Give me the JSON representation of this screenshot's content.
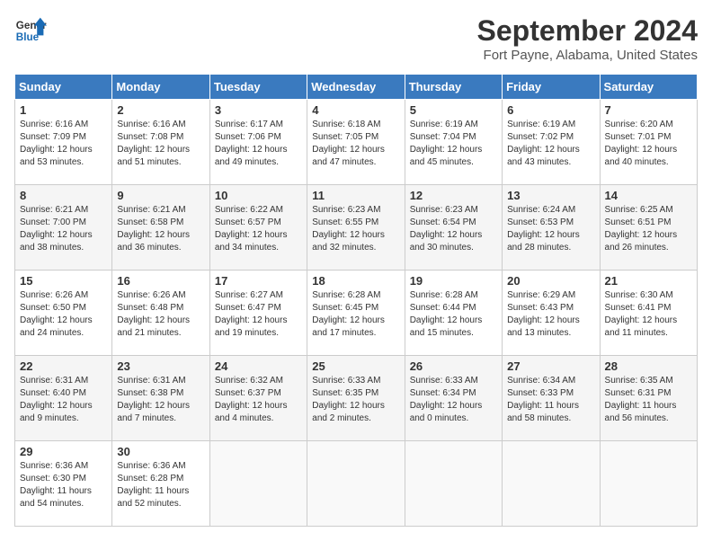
{
  "header": {
    "logo_line1": "General",
    "logo_line2": "Blue",
    "month": "September 2024",
    "location": "Fort Payne, Alabama, United States"
  },
  "weekdays": [
    "Sunday",
    "Monday",
    "Tuesday",
    "Wednesday",
    "Thursday",
    "Friday",
    "Saturday"
  ],
  "weeks": [
    [
      {
        "day": "1",
        "lines": [
          "Sunrise: 6:16 AM",
          "Sunset: 7:09 PM",
          "Daylight: 12 hours",
          "and 53 minutes."
        ]
      },
      {
        "day": "2",
        "lines": [
          "Sunrise: 6:16 AM",
          "Sunset: 7:08 PM",
          "Daylight: 12 hours",
          "and 51 minutes."
        ]
      },
      {
        "day": "3",
        "lines": [
          "Sunrise: 6:17 AM",
          "Sunset: 7:06 PM",
          "Daylight: 12 hours",
          "and 49 minutes."
        ]
      },
      {
        "day": "4",
        "lines": [
          "Sunrise: 6:18 AM",
          "Sunset: 7:05 PM",
          "Daylight: 12 hours",
          "and 47 minutes."
        ]
      },
      {
        "day": "5",
        "lines": [
          "Sunrise: 6:19 AM",
          "Sunset: 7:04 PM",
          "Daylight: 12 hours",
          "and 45 minutes."
        ]
      },
      {
        "day": "6",
        "lines": [
          "Sunrise: 6:19 AM",
          "Sunset: 7:02 PM",
          "Daylight: 12 hours",
          "and 43 minutes."
        ]
      },
      {
        "day": "7",
        "lines": [
          "Sunrise: 6:20 AM",
          "Sunset: 7:01 PM",
          "Daylight: 12 hours",
          "and 40 minutes."
        ]
      }
    ],
    [
      {
        "day": "8",
        "lines": [
          "Sunrise: 6:21 AM",
          "Sunset: 7:00 PM",
          "Daylight: 12 hours",
          "and 38 minutes."
        ]
      },
      {
        "day": "9",
        "lines": [
          "Sunrise: 6:21 AM",
          "Sunset: 6:58 PM",
          "Daylight: 12 hours",
          "and 36 minutes."
        ]
      },
      {
        "day": "10",
        "lines": [
          "Sunrise: 6:22 AM",
          "Sunset: 6:57 PM",
          "Daylight: 12 hours",
          "and 34 minutes."
        ]
      },
      {
        "day": "11",
        "lines": [
          "Sunrise: 6:23 AM",
          "Sunset: 6:55 PM",
          "Daylight: 12 hours",
          "and 32 minutes."
        ]
      },
      {
        "day": "12",
        "lines": [
          "Sunrise: 6:23 AM",
          "Sunset: 6:54 PM",
          "Daylight: 12 hours",
          "and 30 minutes."
        ]
      },
      {
        "day": "13",
        "lines": [
          "Sunrise: 6:24 AM",
          "Sunset: 6:53 PM",
          "Daylight: 12 hours",
          "and 28 minutes."
        ]
      },
      {
        "day": "14",
        "lines": [
          "Sunrise: 6:25 AM",
          "Sunset: 6:51 PM",
          "Daylight: 12 hours",
          "and 26 minutes."
        ]
      }
    ],
    [
      {
        "day": "15",
        "lines": [
          "Sunrise: 6:26 AM",
          "Sunset: 6:50 PM",
          "Daylight: 12 hours",
          "and 24 minutes."
        ]
      },
      {
        "day": "16",
        "lines": [
          "Sunrise: 6:26 AM",
          "Sunset: 6:48 PM",
          "Daylight: 12 hours",
          "and 21 minutes."
        ]
      },
      {
        "day": "17",
        "lines": [
          "Sunrise: 6:27 AM",
          "Sunset: 6:47 PM",
          "Daylight: 12 hours",
          "and 19 minutes."
        ]
      },
      {
        "day": "18",
        "lines": [
          "Sunrise: 6:28 AM",
          "Sunset: 6:45 PM",
          "Daylight: 12 hours",
          "and 17 minutes."
        ]
      },
      {
        "day": "19",
        "lines": [
          "Sunrise: 6:28 AM",
          "Sunset: 6:44 PM",
          "Daylight: 12 hours",
          "and 15 minutes."
        ]
      },
      {
        "day": "20",
        "lines": [
          "Sunrise: 6:29 AM",
          "Sunset: 6:43 PM",
          "Daylight: 12 hours",
          "and 13 minutes."
        ]
      },
      {
        "day": "21",
        "lines": [
          "Sunrise: 6:30 AM",
          "Sunset: 6:41 PM",
          "Daylight: 12 hours",
          "and 11 minutes."
        ]
      }
    ],
    [
      {
        "day": "22",
        "lines": [
          "Sunrise: 6:31 AM",
          "Sunset: 6:40 PM",
          "Daylight: 12 hours",
          "and 9 minutes."
        ]
      },
      {
        "day": "23",
        "lines": [
          "Sunrise: 6:31 AM",
          "Sunset: 6:38 PM",
          "Daylight: 12 hours",
          "and 7 minutes."
        ]
      },
      {
        "day": "24",
        "lines": [
          "Sunrise: 6:32 AM",
          "Sunset: 6:37 PM",
          "Daylight: 12 hours",
          "and 4 minutes."
        ]
      },
      {
        "day": "25",
        "lines": [
          "Sunrise: 6:33 AM",
          "Sunset: 6:35 PM",
          "Daylight: 12 hours",
          "and 2 minutes."
        ]
      },
      {
        "day": "26",
        "lines": [
          "Sunrise: 6:33 AM",
          "Sunset: 6:34 PM",
          "Daylight: 12 hours",
          "and 0 minutes."
        ]
      },
      {
        "day": "27",
        "lines": [
          "Sunrise: 6:34 AM",
          "Sunset: 6:33 PM",
          "Daylight: 11 hours",
          "and 58 minutes."
        ]
      },
      {
        "day": "28",
        "lines": [
          "Sunrise: 6:35 AM",
          "Sunset: 6:31 PM",
          "Daylight: 11 hours",
          "and 56 minutes."
        ]
      }
    ],
    [
      {
        "day": "29",
        "lines": [
          "Sunrise: 6:36 AM",
          "Sunset: 6:30 PM",
          "Daylight: 11 hours",
          "and 54 minutes."
        ]
      },
      {
        "day": "30",
        "lines": [
          "Sunrise: 6:36 AM",
          "Sunset: 6:28 PM",
          "Daylight: 11 hours",
          "and 52 minutes."
        ]
      },
      {
        "day": "",
        "lines": []
      },
      {
        "day": "",
        "lines": []
      },
      {
        "day": "",
        "lines": []
      },
      {
        "day": "",
        "lines": []
      },
      {
        "day": "",
        "lines": []
      }
    ]
  ]
}
